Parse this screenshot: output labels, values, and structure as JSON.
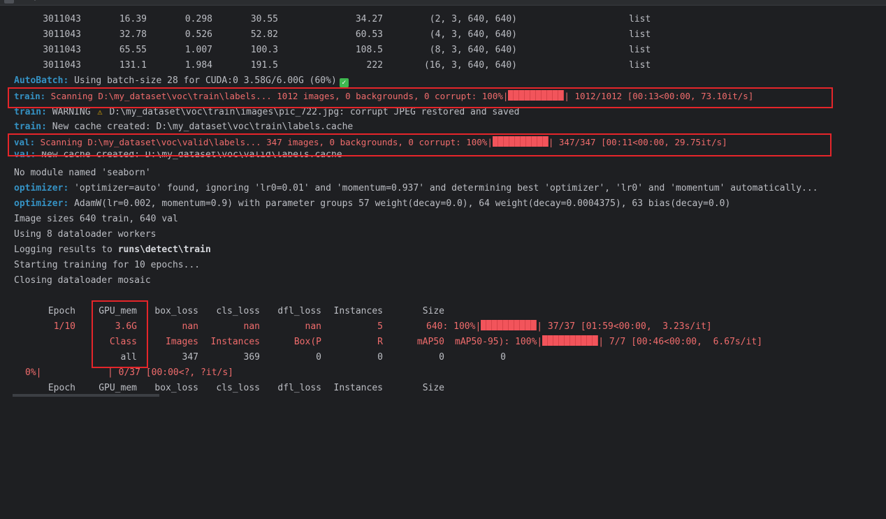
{
  "batch_rows": [
    {
      "params": "3011043",
      "gflops": "16.39",
      "gpu_mem": "0.298",
      "forward": "30.55",
      "backward": "34.27",
      "input": "(2, 3, 640, 640)",
      "output": "list"
    },
    {
      "params": "3011043",
      "gflops": "32.78",
      "gpu_mem": "0.526",
      "forward": "52.82",
      "backward": "60.53",
      "input": "(4, 3, 640, 640)",
      "output": "list"
    },
    {
      "params": "3011043",
      "gflops": "65.55",
      "gpu_mem": "1.007",
      "forward": "100.3",
      "backward": "108.5",
      "input": "(8, 3, 640, 640)",
      "output": "list"
    },
    {
      "params": "3011043",
      "gflops": "131.1",
      "gpu_mem": "1.984",
      "forward": "191.5",
      "backward": "222",
      "input": "(16, 3, 640, 640)",
      "output": "list"
    }
  ],
  "autobatch": {
    "prefix": "AutoBatch:",
    "text": " Using batch-size 28 for CUDA:0 3.58G/6.00G (60%)"
  },
  "train_scan": {
    "prefix": "train:",
    "text": " Scanning D:\\my_dataset\\voc\\train\\labels... 1012 images, 0 backgrounds, 0 corrupt: 100%|",
    "tail": "| 1012/1012 [00:13<00:00, 73.10it/s]"
  },
  "train_warn": {
    "prefix": "train:",
    "pre": " WARNING ",
    "text": " D:\\my_dataset\\voc\\train\\images\\pic_722.jpg: corrupt JPEG restored and saved"
  },
  "train_cache": {
    "prefix": "train:",
    "text": " New cache created: D:\\my_dataset\\voc\\train\\labels.cache"
  },
  "val_scan": {
    "prefix": "val:",
    "text": " Scanning D:\\my_dataset\\voc\\valid\\labels... 347 images, 0 backgrounds, 0 corrupt: 100%|",
    "tail": "| 347/347 [00:11<00:00, 29.75it/s]"
  },
  "val_cache": {
    "prefix": "val:",
    "text": " New cache created: D:\\my_dataset\\voc\\valid\\labels.cache"
  },
  "no_module": "No module named 'seaborn'",
  "optimizer1": {
    "prefix": "optimizer:",
    "text": " 'optimizer=auto' found, ignoring 'lr0=0.01' and 'momentum=0.937' and determining best 'optimizer', 'lr0' and 'momentum' automatically..."
  },
  "optimizer2": {
    "prefix": "optimizer:",
    "text": " AdamW(lr=0.002, momentum=0.9) with parameter groups 57 weight(decay=0.0), 64 weight(decay=0.0004375), 63 bias(decay=0.0)"
  },
  "image_sizes": "Image sizes 640 train, 640 val",
  "workers": "Using 8 dataloader workers",
  "logging": {
    "text": "Logging results to ",
    "path": "runs\\detect\\train"
  },
  "starting": "Starting training for 10 epochs...",
  "closing": "Closing dataloader mosaic",
  "epoch_header": [
    "Epoch",
    "GPU_mem",
    "box_loss",
    "cls_loss",
    "dfl_loss",
    "Instances",
    "Size"
  ],
  "epoch_row": {
    "epoch": "1/10",
    "gpu_mem": "3.6G",
    "box_loss": "nan",
    "cls_loss": "nan",
    "dfl_loss": "nan",
    "instances": "5",
    "size": "640: 100%|",
    "tail": "| 37/37 [01:59<00:00,  3.23s/it]"
  },
  "val_header": {
    "class": "Class",
    "images": "Images",
    "instances": "Instances",
    "box": "Box(P",
    "r": "R",
    "map50": "mAP50",
    "map5095": "mAP50-95): 100%|",
    "tail": "| 7/7 [00:46<00:00,  6.67s/it]"
  },
  "val_row": {
    "class": "all",
    "images": "347",
    "instances": "369",
    "p": "0",
    "r": "0",
    "map50": "0",
    "map5095": "0"
  },
  "progress_row": {
    "pct": "0%|",
    "tail": "| 0/37 [00:00<?, ?it/s]"
  },
  "icons": {
    "check": "check-icon",
    "warning": "warning-icon"
  },
  "colors": {
    "background": "#1e1f22",
    "error_text": "#f06c6c",
    "prefix_blue": "#3592c4",
    "highlight_box": "#e5252a",
    "progress_bar": "#f2545b"
  }
}
